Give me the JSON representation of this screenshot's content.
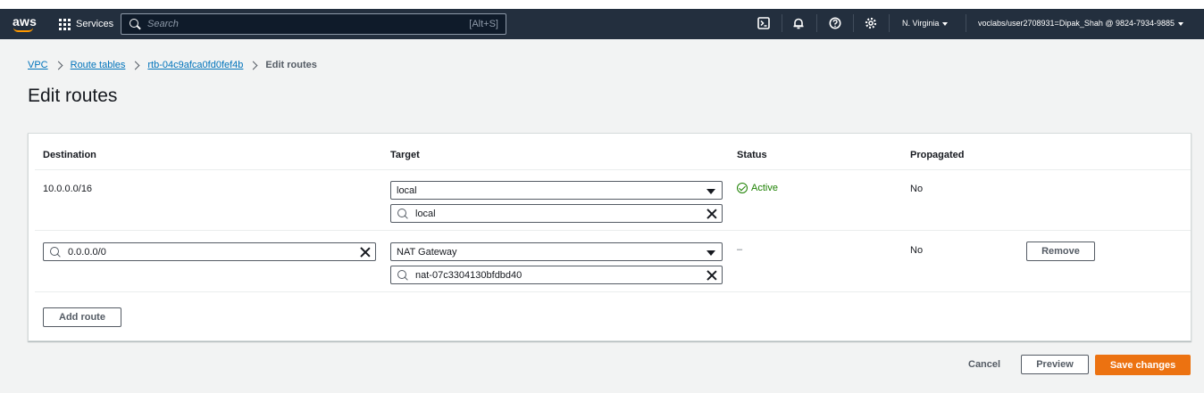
{
  "topbar": {
    "logo": "aws",
    "services_label": "Services",
    "search_placeholder": "Search",
    "search_shortcut": "[Alt+S]",
    "region": "N. Virginia",
    "account": "voclabs/user2708931=Dipak_Shah @ 9824-7934-9885"
  },
  "breadcrumb": {
    "items": [
      "VPC",
      "Route tables",
      "rtb-04c9afca0fd0fef4b"
    ],
    "current": "Edit routes"
  },
  "page": {
    "title": "Edit routes"
  },
  "table": {
    "headers": [
      "Destination",
      "Target",
      "Status",
      "Propagated"
    ],
    "rows": [
      {
        "destination": "10.0.0.0/16",
        "target_type": "local",
        "target_value": "local",
        "status": "Active",
        "propagated": "No"
      },
      {
        "destination": "0.0.0.0/0",
        "target_type": "NAT Gateway",
        "target_value": "nat-07c3304130bfdbd40",
        "status": "–",
        "propagated": "No",
        "remove_label": "Remove"
      }
    ],
    "add_route_label": "Add route"
  },
  "footer": {
    "cancel_label": "Cancel",
    "preview_label": "Preview",
    "save_label": "Save changes"
  },
  "colors": {
    "topbar": "#232f3e",
    "primary_button": "#ec7211",
    "link": "#0073bb",
    "success": "#1d8102"
  }
}
